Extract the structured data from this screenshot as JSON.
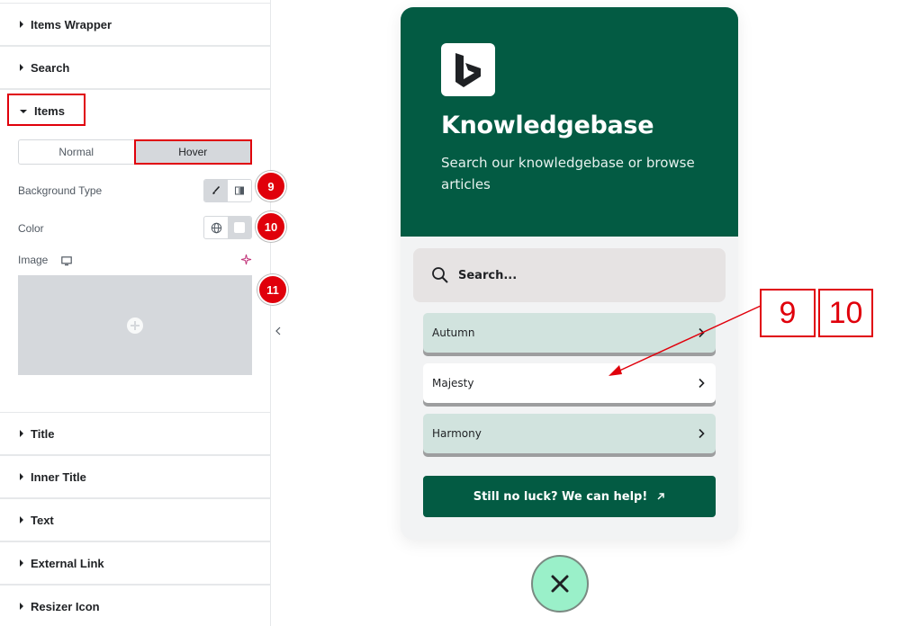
{
  "panel": {
    "sections_top": [
      {
        "label": "Items Wrapper"
      },
      {
        "label": "Search"
      }
    ],
    "items_section": {
      "label": "Items"
    },
    "tabs": [
      {
        "label": "Normal"
      },
      {
        "label": "Hover"
      }
    ],
    "controls": {
      "background_type": "Background Type",
      "color": "Color",
      "image": "Image"
    },
    "badges": [
      "9",
      "10",
      "11"
    ],
    "sections_bottom": [
      {
        "label": "Title"
      },
      {
        "label": "Inner Title"
      },
      {
        "label": "Text"
      },
      {
        "label": "External Link"
      },
      {
        "label": "Resizer Icon"
      }
    ]
  },
  "preview": {
    "title": "Knowledgebase",
    "subtitle": "Search our knowledgebase or browse articles",
    "search_placeholder": "Search...",
    "items": [
      {
        "label": "Autumn"
      },
      {
        "label": "Majesty"
      },
      {
        "label": "Harmony"
      }
    ],
    "help_button": "Still no luck? We can help!"
  },
  "annotations": {
    "box_a": "9",
    "box_b": "10"
  },
  "colors": {
    "accent_red": "#e0000b",
    "brand_green": "#035b43",
    "item_mint": "#d1e3de",
    "close_green": "#9af0c9"
  },
  "icons": {
    "logo": "bing-logo-icon",
    "search": "search-icon",
    "chevron": "chevron-right-icon",
    "close": "close-icon",
    "arrow_out": "arrow-up-right-icon"
  }
}
